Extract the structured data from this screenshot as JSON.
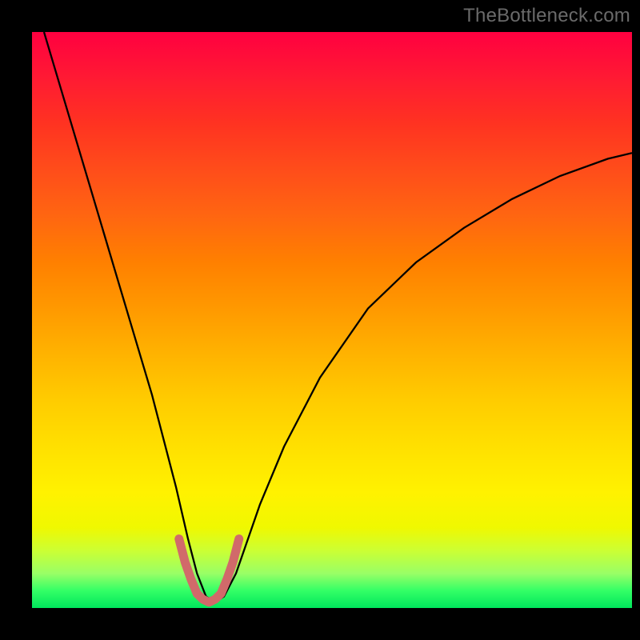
{
  "watermark": {
    "text": "TheBottleneck.com"
  },
  "chart_data": {
    "type": "line",
    "title": "",
    "xlabel": "",
    "ylabel": "",
    "xlim": [
      0,
      100
    ],
    "ylim": [
      0,
      100
    ],
    "grid": false,
    "legend": false,
    "background_gradient": {
      "top_color": "#ff0040",
      "bottom_color": "#00e65c",
      "note": "vertical rainbow gradient red→orange→yellow→green representing quality from bad (top) to good (bottom)"
    },
    "series": [
      {
        "name": "bottleneck-curve",
        "color": "#000000",
        "stroke_width": 2.3,
        "x": [
          2,
          4,
          6,
          8,
          10,
          12,
          14,
          16,
          18,
          20,
          22,
          24,
          26,
          27.5,
          29,
          30.5,
          32,
          34,
          36,
          38,
          42,
          48,
          56,
          64,
          72,
          80,
          88,
          96,
          100
        ],
        "values": [
          100,
          93,
          86,
          79,
          72,
          65,
          58,
          51,
          44,
          37,
          29,
          21,
          12,
          6,
          2,
          1,
          2,
          6,
          12,
          18,
          28,
          40,
          52,
          60,
          66,
          71,
          75,
          78,
          79
        ]
      },
      {
        "name": "valley-highlight",
        "color": "#d16a6a",
        "stroke_width": 11,
        "linecap": "round",
        "note": "rounded stubby marker tracing the valley bottom",
        "x": [
          24.5,
          25.5,
          26.5,
          27.5,
          28.5,
          29.5,
          30.5,
          31.5,
          32.5,
          33.5,
          34.5
        ],
        "values": [
          12,
          8,
          5,
          2.5,
          1.5,
          1,
          1.5,
          2.5,
          5,
          8,
          12
        ]
      }
    ],
    "optimum_x": 30,
    "annotations": []
  }
}
